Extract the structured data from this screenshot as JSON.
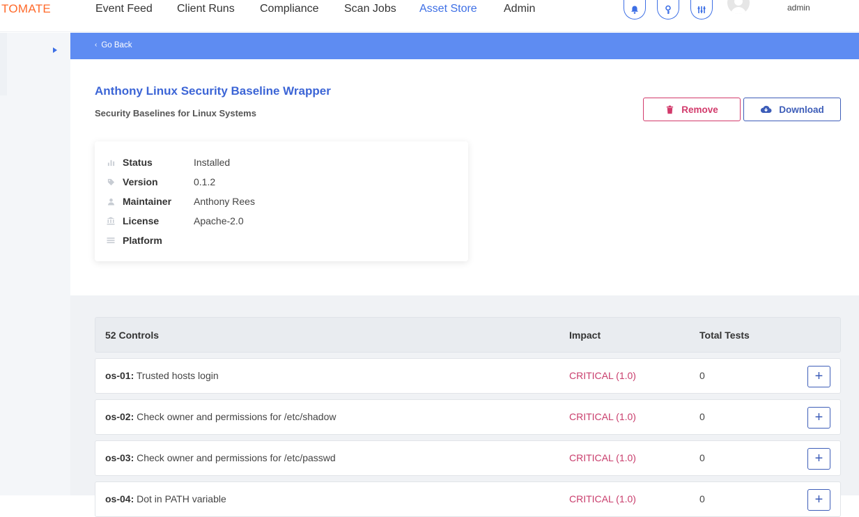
{
  "brand": "TOMATE",
  "nav": {
    "items": [
      {
        "label": "Event Feed"
      },
      {
        "label": "Client Runs"
      },
      {
        "label": "Compliance"
      },
      {
        "label": "Scan Jobs"
      },
      {
        "label": "Asset Store"
      },
      {
        "label": "Admin"
      }
    ],
    "active": "Asset Store",
    "user": "admin",
    "icons": [
      "bell-icon",
      "key-icon",
      "settings-sliders-icon"
    ]
  },
  "back": {
    "label": "Go Back"
  },
  "profile": {
    "title": "Anthony Linux Security Baseline Wrapper",
    "subtitle": "Security Baselines for Linux Systems",
    "remove_label": "Remove",
    "download_label": "Download",
    "info": [
      {
        "key": "Status",
        "value": "Installed",
        "icon": "bar-chart-icon"
      },
      {
        "key": "Version",
        "value": "0.1.2",
        "icon": "tag-icon"
      },
      {
        "key": "Maintainer",
        "value": "Anthony Rees",
        "icon": "user-icon"
      },
      {
        "key": "License",
        "value": "Apache-2.0",
        "icon": "bank-icon"
      },
      {
        "key": "Platform",
        "value": "",
        "icon": "list-icon"
      }
    ]
  },
  "controls": {
    "header": {
      "count": "52 Controls",
      "impact": "Impact",
      "total_tests": "Total Tests"
    },
    "rows": [
      {
        "id": "os-01:",
        "title": " Trusted hosts login",
        "impact": "CRITICAL (1.0)",
        "tests": "0"
      },
      {
        "id": "os-02:",
        "title": " Check owner and permissions for /etc/shadow",
        "impact": "CRITICAL (1.0)",
        "tests": "0"
      },
      {
        "id": "os-03:",
        "title": " Check owner and permissions for /etc/passwd",
        "impact": "CRITICAL (1.0)",
        "tests": "0"
      },
      {
        "id": "os-04:",
        "title": " Dot in PATH variable",
        "impact": "CRITICAL (1.0)",
        "tests": "0"
      }
    ]
  },
  "colors": {
    "accent": "#3d6fe5",
    "brand": "#ff6a2b",
    "critical": "#c93d6c",
    "backbar": "#5e8cf2"
  }
}
